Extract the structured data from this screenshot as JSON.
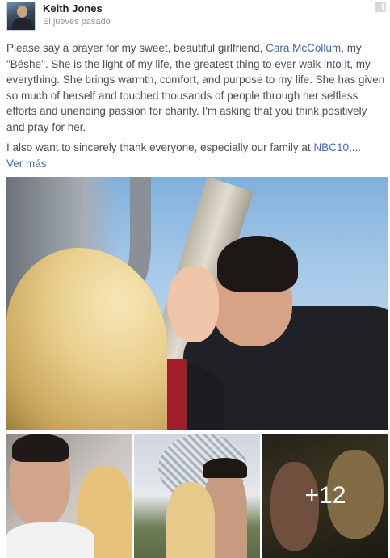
{
  "post": {
    "author": "Keith Jones",
    "timestamp": "El jueves pasado",
    "source_icon": "facebook-icon",
    "paragraph1": {
      "before_link": "Please say a prayer for my sweet, beautiful girlfriend, ",
      "mention": "Cara McCollum",
      "after_link": ", my \"Béshe\". She is the light of my life, the greatest thing to ever walk into it, my everything. She brings warmth, comfort, and purpose to my life. She has given so much of herself and touched thousands of people through her selfless efforts and unending passion for charity. I'm asking that you think positively and pray for her."
    },
    "paragraph2": {
      "before_link": "I also want to sincerely thank everyone, especially our family at ",
      "mention": "NBC10",
      "after_link": ",..."
    },
    "see_more": "Ver más",
    "more_photos_label": "+12"
  },
  "colors": {
    "link": "#4267b2",
    "body_text": "#4b4f56",
    "author_text": "#1d2129",
    "meta_text": "#90949c"
  }
}
